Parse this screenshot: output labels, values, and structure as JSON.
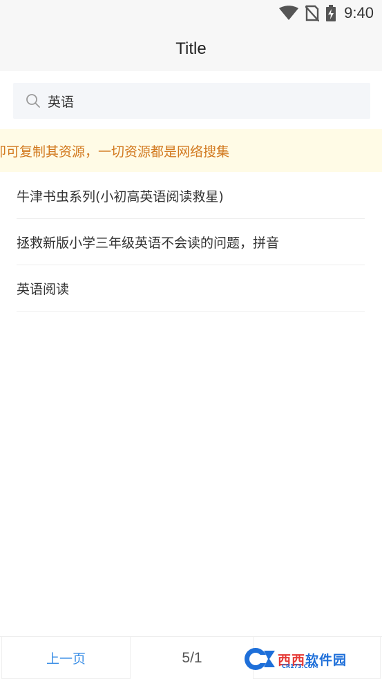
{
  "status_bar": {
    "time": "9:40",
    "icons": [
      "wifi-icon",
      "no-sim-icon",
      "battery-charging-icon"
    ]
  },
  "header": {
    "title": "Title"
  },
  "search": {
    "value": "英语",
    "icon": "search-icon"
  },
  "notice": {
    "text": "即可复制其资源，一切资源都是网络搜集",
    "color": "#d2791f"
  },
  "results": [
    {
      "label": "牛津书虫系列(小初高英语阅读救星)"
    },
    {
      "label": "拯救新版小学三年级英语不会读的问题，拼音"
    },
    {
      "label": "英语阅读"
    }
  ],
  "pager": {
    "prev_label": "上一页",
    "page_count": "5/1",
    "accent": "#3a8ee6"
  },
  "watermark": {
    "brand_a": "西西",
    "brand_b": "软件园",
    "domain": "CR173.COM"
  }
}
